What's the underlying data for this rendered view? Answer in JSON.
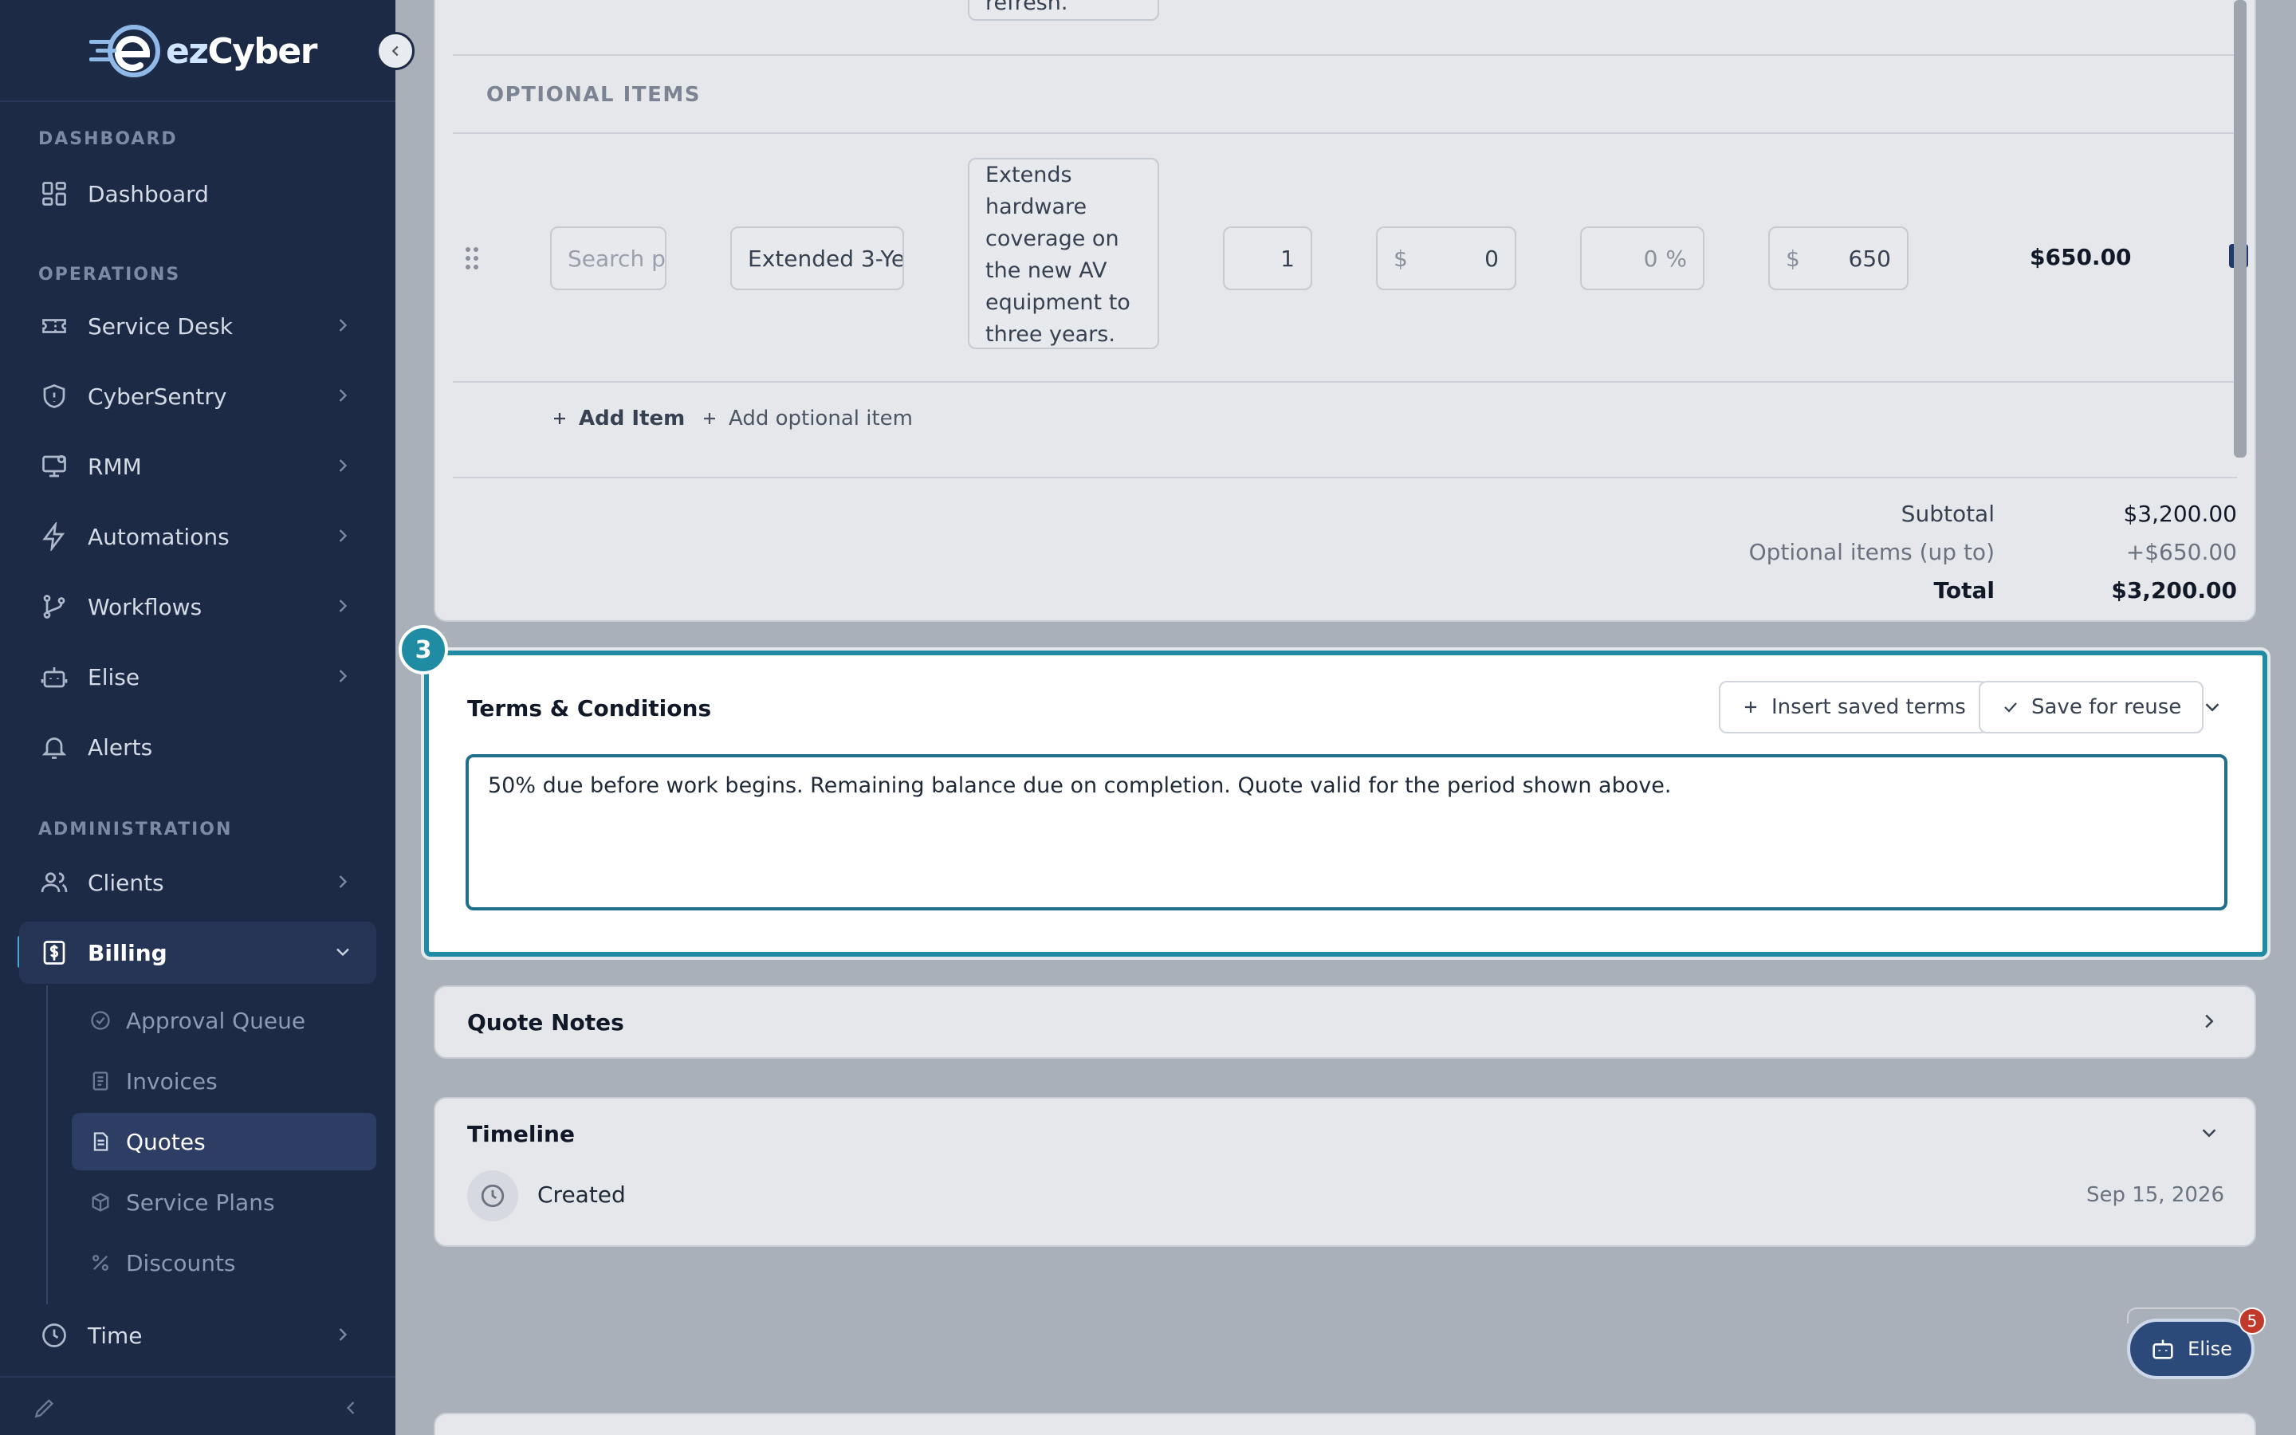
{
  "brand": {
    "name_ez": "ez",
    "name_rest": "Cyber"
  },
  "sidebar": {
    "sections": {
      "dashboard": "DASHBOARD",
      "operations": "OPERATIONS",
      "administration": "ADMINISTRATION"
    },
    "items": {
      "dashboard": "Dashboard",
      "service_desk": "Service Desk",
      "cybersentry": "CyberSentry",
      "rmm": "RMM",
      "automations": "Automations",
      "workflows": "Workflows",
      "elise": "Elise",
      "alerts": "Alerts",
      "clients": "Clients",
      "billing": "Billing",
      "time": "Time"
    },
    "billing_sub": {
      "approval_queue": "Approval Queue",
      "invoices": "Invoices",
      "quotes": "Quotes",
      "service_plans": "Service Plans",
      "discounts": "Discounts"
    },
    "active_item": "Billing",
    "active_sub_item": "Quotes"
  },
  "items_table": {
    "prev_textarea_tail": "refresh.",
    "optional_label": "OPTIONAL ITEMS",
    "optional_row": {
      "search_placeholder": "Search p",
      "name": "Extended 3-Ye",
      "description_lines": [
        "Extends",
        "hardware",
        "coverage on",
        "the new AV",
        "equipment to",
        "three years."
      ],
      "quantity": "1",
      "cost_prefix": "$",
      "cost": "0",
      "discount": "0",
      "discount_suffix": "%",
      "price_prefix": "$",
      "price": "650",
      "line_total": "$650.00"
    },
    "add_item": "Add Item",
    "add_optional_item": "Add optional item",
    "totals": {
      "subtotal_label": "Subtotal",
      "subtotal_value": "$3,200.00",
      "optional_label": "Optional items (up to)",
      "optional_value": "+$650.00",
      "total_label": "Total",
      "total_value": "$3,200.00"
    }
  },
  "terms": {
    "step_number": "3",
    "title": "Terms & Conditions",
    "insert_button": "Insert saved terms",
    "save_button": "Save for reuse",
    "text": "50% due before work begins. Remaining balance due on completion. Quote valid for the period shown above."
  },
  "quote_notes": {
    "title": "Quote Notes"
  },
  "timeline": {
    "title": "Timeline",
    "events": [
      {
        "label": "Created",
        "date": "Sep 15, 2026"
      }
    ]
  },
  "assistant": {
    "label": "Elise",
    "badge_count": "5"
  },
  "colors": {
    "sidebar_bg": "#1d2a46",
    "accent": "#1f8ca3",
    "badge": "#c0392b"
  }
}
